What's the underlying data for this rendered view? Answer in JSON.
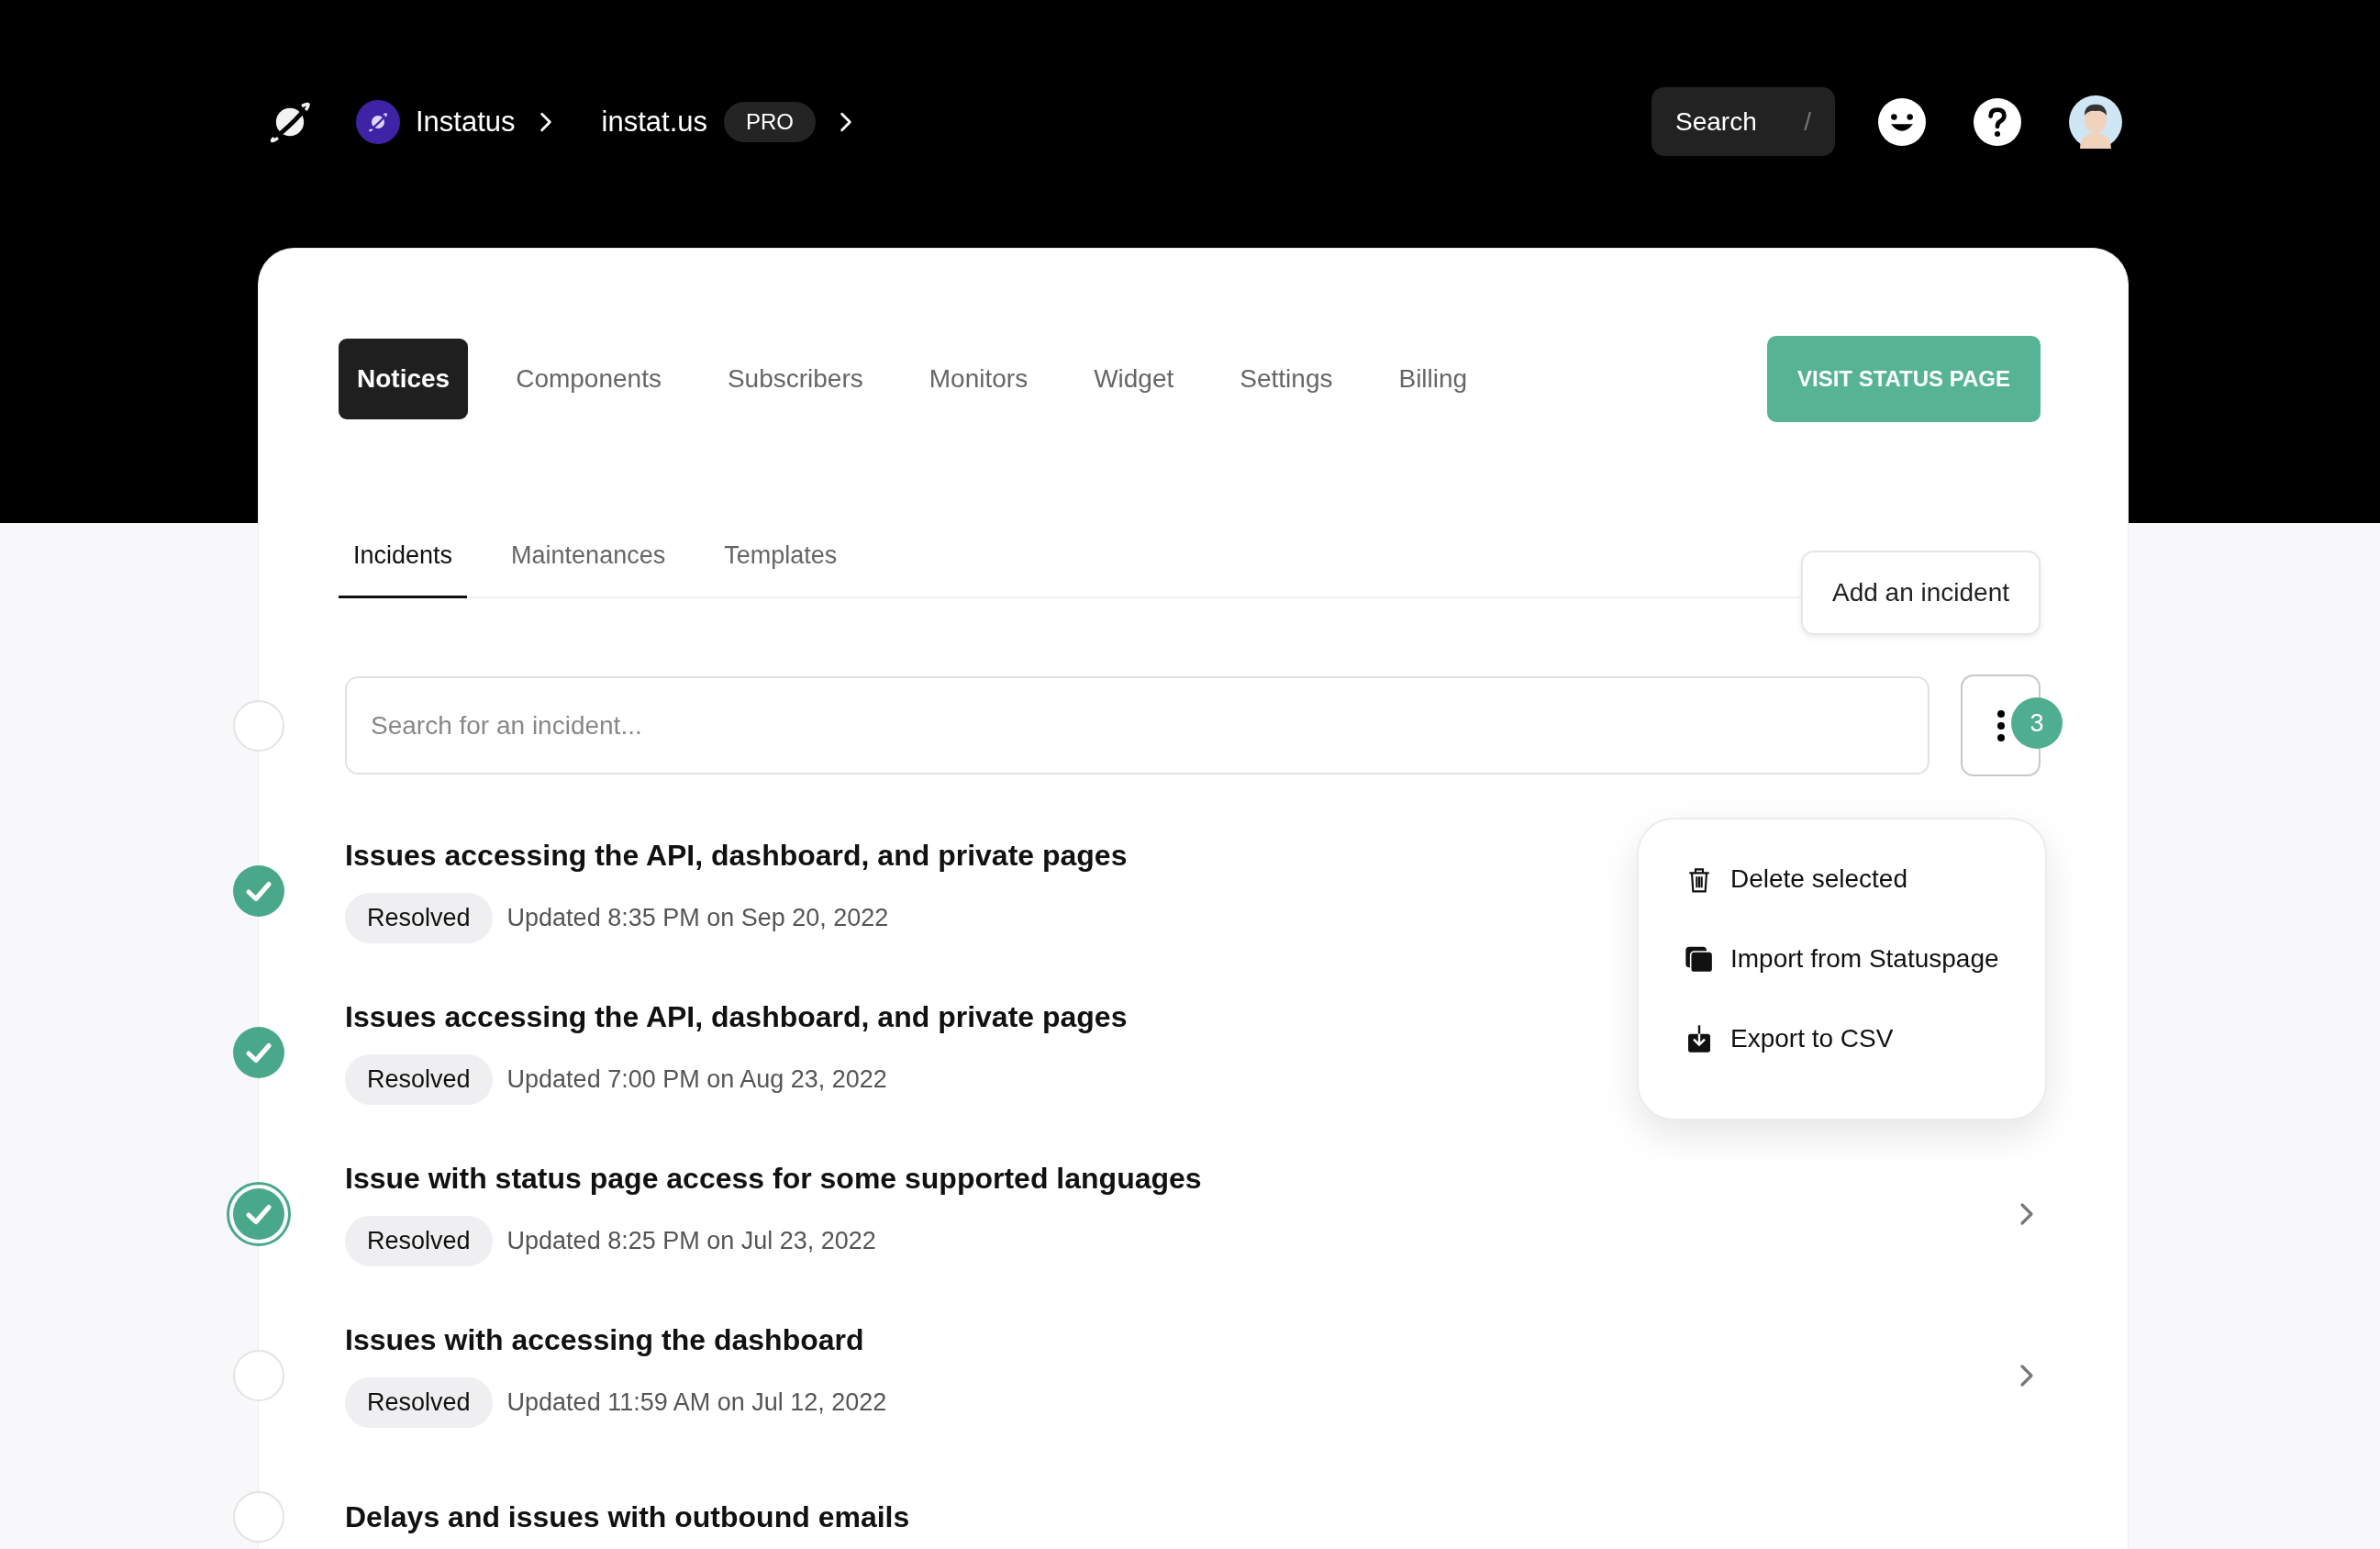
{
  "nav": {
    "breadcrumbs": [
      {
        "label": "Instatus",
        "kind": "org"
      },
      {
        "label": "instat.us",
        "kind": "site",
        "badge": "PRO"
      }
    ],
    "search": {
      "placeholder": "Search",
      "shortcut": "/"
    }
  },
  "tabs": [
    {
      "label": "Notices",
      "selected": true
    },
    {
      "label": "Components",
      "selected": false
    },
    {
      "label": "Subscribers",
      "selected": false
    },
    {
      "label": "Monitors",
      "selected": false
    },
    {
      "label": "Widget",
      "selected": false
    },
    {
      "label": "Settings",
      "selected": false
    },
    {
      "label": "Billing",
      "selected": false
    }
  ],
  "visit_button": "VISIT STATUS PAGE",
  "subtabs": [
    {
      "label": "Incidents",
      "selected": true
    },
    {
      "label": "Maintenances",
      "selected": false
    },
    {
      "label": "Templates",
      "selected": false
    }
  ],
  "add_button": "Add an incident",
  "incident_search": {
    "placeholder": "Search for an incident...",
    "select_all": false
  },
  "selection_count": "3",
  "menu": {
    "items": [
      {
        "label": "Delete selected",
        "kind": "trash"
      },
      {
        "label": "Import from Statuspage",
        "kind": "import"
      },
      {
        "label": "Export to CSV",
        "kind": "export"
      }
    ]
  },
  "incidents": [
    {
      "title": "Issues accessing the API, dashboard, and private pages",
      "status": "Resolved",
      "updated": "Updated 8:35 PM on Sep 20, 2022",
      "checked": true,
      "highlighted": false,
      "chevron": false
    },
    {
      "title": "Issues accessing the API, dashboard, and private pages",
      "status": "Resolved",
      "updated": "Updated 7:00 PM on Aug 23, 2022",
      "checked": true,
      "highlighted": false,
      "chevron": false
    },
    {
      "title": "Issue with status page access for some supported languages",
      "status": "Resolved",
      "updated": "Updated 8:25 PM on Jul 23, 2022",
      "checked": true,
      "highlighted": true,
      "chevron": true
    },
    {
      "title": "Issues with accessing the dashboard",
      "status": "Resolved",
      "updated": "Updated 11:59 AM on Jul 12, 2022",
      "checked": false,
      "highlighted": false,
      "chevron": true
    },
    {
      "title": "Delays and issues with outbound emails",
      "checked": false,
      "highlighted": false,
      "chevron": false
    }
  ]
}
